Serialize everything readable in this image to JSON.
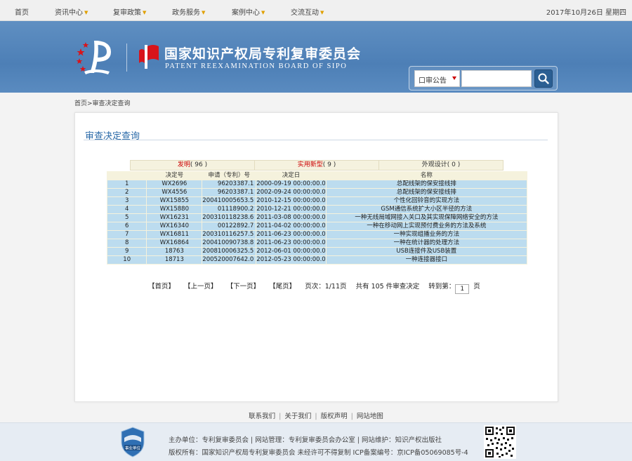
{
  "topnav": {
    "items": [
      {
        "label": "首页",
        "has_menu": false
      },
      {
        "label": "资讯中心",
        "has_menu": true
      },
      {
        "label": "复审政策",
        "has_menu": true
      },
      {
        "label": "政务服务",
        "has_menu": true
      },
      {
        "label": "案例中心",
        "has_menu": true
      },
      {
        "label": "交流互动",
        "has_menu": true
      }
    ],
    "date": "2017年10月26日 星期四"
  },
  "header": {
    "logo_cn": "国家知识产权局专利复审委员会",
    "logo_en": "PATENT REEXAMINATION BOARD OF SIPO",
    "search": {
      "category": "口审公告",
      "input_value": "",
      "button_icon": "search-icon"
    }
  },
  "breadcrumb": "首页>审查决定查询",
  "main": {
    "title": "审查决定查询",
    "tabs": [
      {
        "name": "发明",
        "count": "( 96 )",
        "highlight": true
      },
      {
        "name": "实用新型",
        "count": "( 9 )",
        "highlight": true
      },
      {
        "name": "外观设计",
        "count": "( 0 )",
        "highlight": false
      }
    ],
    "table": {
      "headers": [
        "",
        "决定号",
        "申请（专利）号",
        "决定日",
        "名称"
      ],
      "rows": [
        [
          "1",
          "WX2696",
          "96203387.1",
          "2000-09-19 00:00:00.0",
          "总配线架的保安接线排"
        ],
        [
          "2",
          "WX4556",
          "96203387.1",
          "2002-09-24 00:00:00.0",
          "总配线架的保安接线排"
        ],
        [
          "3",
          "WX15855",
          "200410005653.5",
          "2010-12-15 00:00:00.0",
          "个性化回铃音的实现方法"
        ],
        [
          "4",
          "WX15880",
          "01118900.2",
          "2010-12-21 00:00:00.0",
          "GSM通信系统扩大小区半径的方法"
        ],
        [
          "5",
          "WX16231",
          "200310118238.6",
          "2011-03-08 00:00:00.0",
          "一种无线局域网接入关口及其实现保障网络安全的方法"
        ],
        [
          "6",
          "WX16340",
          "00122892.7",
          "2011-04-02 00:00:00.0",
          "一种在移动网上实现预付费业务的方法及系统"
        ],
        [
          "7",
          "WX16811",
          "200310116257.5",
          "2011-06-23 00:00:00.0",
          "一种实现组播业务的方法"
        ],
        [
          "8",
          "WX16864",
          "200410090738.8",
          "2011-06-23 00:00:00.0",
          "一种在统计器的处理方法"
        ],
        [
          "9",
          "18763",
          "200810006325.5",
          "2012-06-01 00:00:00.0",
          "USB连接件及USB装置"
        ],
        [
          "10",
          "18713",
          "200520007642.0",
          "2012-05-23 00:00:00.0",
          "一种连接器接口"
        ]
      ]
    },
    "pager": {
      "first": "【首页】",
      "prev": "【上一页】",
      "next": "【下一页】",
      "last": "【尾页】",
      "page_info": "页次：1/11页",
      "total": "共有 105 件审查决定",
      "goto_label": "转到第：",
      "goto_value": "1",
      "goto_suffix": "页"
    }
  },
  "footer": {
    "links": [
      "联系我们",
      "关于我们",
      "版权声明",
      "网站地图"
    ],
    "line1": "主办单位：专利复审委员会 | 网站管理：专利复审委员会办公室 | 网站维护：知识产权出版社",
    "line2": "版权所有：国家知识产权局专利复审委员会 未经许可不得复制 ICP备案编号：京ICP备05069085号-4",
    "badge_text": "事业单位"
  },
  "colors": {
    "banner": "#5583b9",
    "row_bg": "#bcdcef",
    "tab_bg": "#f5f2df",
    "accent_red": "#cc0000",
    "title_blue": "#2a6aa8"
  }
}
